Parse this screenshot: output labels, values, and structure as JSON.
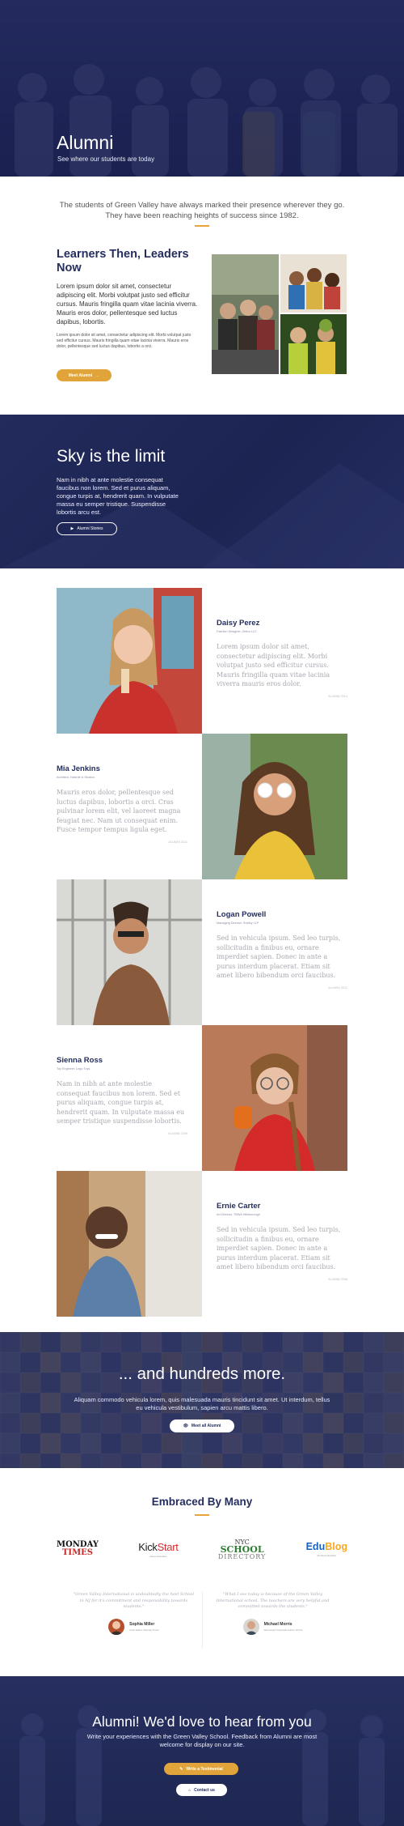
{
  "colors": {
    "navy": "#242e5e",
    "accent": "#e0a43a",
    "muted_text": "#a8a8b0"
  },
  "hero": {
    "title": "Alumni",
    "subtitle": "See where our students are today"
  },
  "intro": {
    "text": "The students of Green Valley have always marked their presence wherever they go. They have been reaching heights of success since 1982."
  },
  "learners": {
    "title": "Learners Then, Leaders Now",
    "body": "Lorem ipsum dolor sit amet, consectetur adipiscing elit. Morbi volutpat justo sed efficitur cursus. Mauris fringilla quam vitae lacinia viverra. Mauris eros dolor, pellentesque sed luctus dapibus, lobortis.",
    "small": "Lorem ipsum dolor sit amet, consectetur adipiscing elit. Morbi volutpat justo sed efficitur cursus. Mauris fringilla quam vitae lacinia viverra. Mauris eros dolor, pellentesque sed luctus dapibus, lobortis a orci.",
    "button": "Meet Alumni",
    "button_icon": "arrow-right-icon"
  },
  "sky": {
    "title": "Sky is the limit",
    "body": "Nam in nibh at ante molestie consequat faucibus non lorem. Sed et purus aliquam, congue turpis at, hendrerit quam. In vulputate massa eu semper tristique. Suspendisse lobortis arcu est.",
    "button": "Alumni Stories",
    "button_icon": "play-icon"
  },
  "alumni": [
    {
      "name": "Daisy Perez",
      "role": "Fashion Designer, Zebra LLC",
      "quote": "Lorem ipsum dolor sit amet, consectetur adipiscing elit. Morbi volutpat justo sed efficitur cursus. Mauris fringilla quam vitae lacinia viverra mauris eros dolor.",
      "date": "ALUMNI 2014"
    },
    {
      "name": "Mia Jenkins",
      "role": "Architect, Hatchie & Studios",
      "quote": "Mauris eros dolor, pellentesque sed luctus dapibus, lobortis a orci. Cras pulvinar lorem elit, vel laoreet magna feugiat nec. Nam ut consequat enim. Fusce tempor tempus ligula eget.",
      "date": "ALUMNI 2011"
    },
    {
      "name": "Logan Powell",
      "role": "Managing Director, Shelby LLP",
      "quote": "Sed in vehicula ipsum. Sed leo turpis, sollicitudin a finibus eu, ornare imperdiet sapien. Donec in ante a purus interdum placerat. Etiam sit amet libero bibendum orci faucibus.",
      "date": "ALUMNI 2011"
    },
    {
      "name": "Sienna Ross",
      "role": "Toy Engineer, Lego Toys",
      "quote": "Nam in nibh at ante molestie consequat faucibus non lorem. Sed et purus aliquam, congue turpis at, hendrerit quam. In vulputate massa eu semper tristique suspendisse lobortis.",
      "date": "ALUMNI 2009"
    },
    {
      "name": "Ernie Carter",
      "role": "Art Director, TBWA Hillsborough",
      "quote": "Sed in vehicula ipsum. Sed leo turpis, sollicitudin a finibus eu, ornare imperdiet sapien. Donec in ante a purus interdum placerat. Etiam sit amet libero bibendum orci faucibus.",
      "date": "ALUMNI 2008"
    }
  ],
  "hundreds": {
    "title": "... and hundreds more.",
    "body": "Aliquam commodo vehicula lorem, quis malesuada mauris tincidunt sit amet. Ut interdum, tellus eu vehicula vestibulum, sapien arcu mattis libero.",
    "button": "Meet all Alumni",
    "button_icon": "eye-icon"
  },
  "embraced": {
    "title": "Embraced By Many",
    "logos": [
      {
        "line1": "MONDAY",
        "line2": "TIMES"
      },
      {
        "line1": "Kick",
        "line2": "Start",
        "sub": "Career Education"
      },
      {
        "line1": "NYC",
        "line2": "SCHOOL",
        "line3": "DIRECTORY"
      },
      {
        "line1": "Edu",
        "line2": "Blog",
        "sub": "All about education"
      }
    ],
    "testimonials": [
      {
        "quote": "\"Green Valley International is undoubtedly the best School in NJ for it's commitment and responsibility towards students.\"",
        "name": "Sophia Miller",
        "role": "Chief Editor, Monday Times"
      },
      {
        "quote": "\"What I see today is because of the Green Valley International school. The teachers are very helpful and committed towards the students.\"",
        "name": "Michael Morris",
        "role": "Renowned Corporate Author, NYCS"
      }
    ]
  },
  "cta": {
    "title": "Alumni! We'd love to hear from you",
    "body": "Write your experiences with the Green Valley School. Feedback from Alumni are most welcome for display on our site.",
    "button_primary": "Write a Testimonial",
    "button_primary_icon": "pencil-icon",
    "button_secondary": "Contact us",
    "button_secondary_icon": "home-icon"
  }
}
